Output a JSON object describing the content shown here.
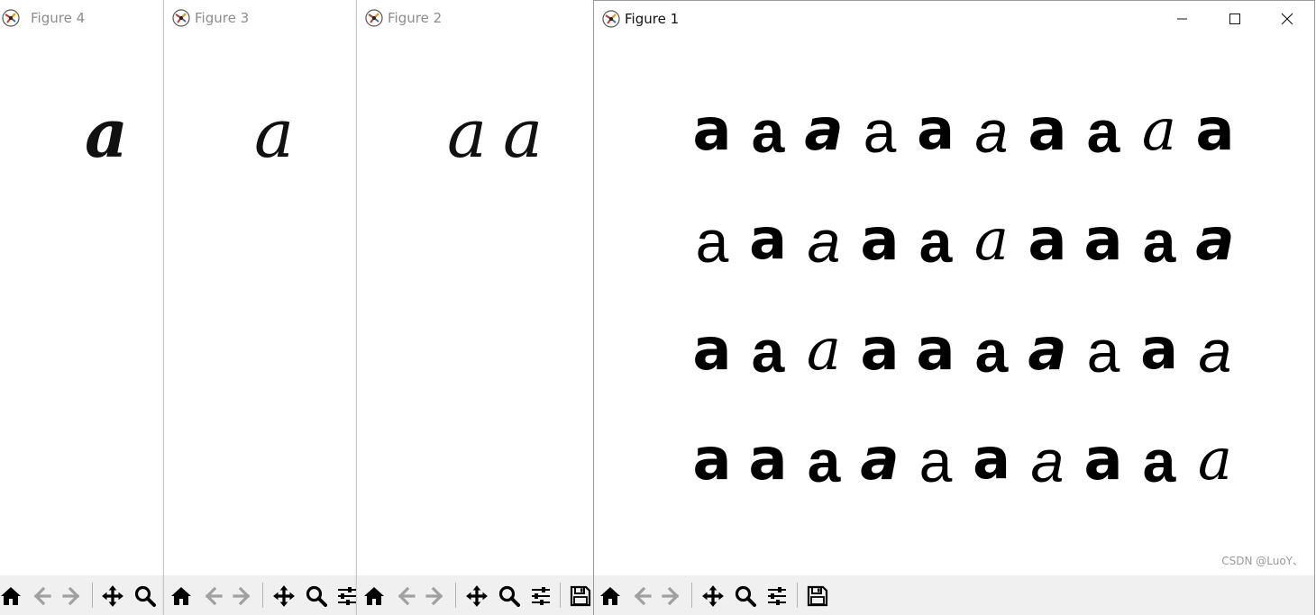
{
  "figures": [
    {
      "id": "figure4",
      "title": "Figure 4",
      "glyphs": [
        "a"
      ]
    },
    {
      "id": "figure3",
      "title": "Figure 3",
      "glyphs": [
        "a"
      ]
    },
    {
      "id": "figure2",
      "title": "Figure 2",
      "glyphs": [
        "a",
        "a"
      ]
    },
    {
      "id": "figure1",
      "title": "Figure 1",
      "grid": [
        [
          "a",
          "a",
          "a",
          "a",
          "a",
          "a",
          "a",
          "a",
          "a",
          "a"
        ],
        [
          "a",
          "a",
          "a",
          "a",
          "a",
          "a",
          "a",
          "a",
          "a",
          "a"
        ],
        [
          "a",
          "a",
          "a",
          "a",
          "a",
          "a",
          "a",
          "a",
          "a",
          "a"
        ],
        [
          "a",
          "a",
          "a",
          "a",
          "a",
          "a",
          "a",
          "a",
          "a",
          "a"
        ]
      ]
    }
  ],
  "toolbar": {
    "icons": [
      "home-icon",
      "back-arrow-icon",
      "forward-arrow-icon",
      "pan-icon",
      "zoom-icon",
      "configure-subplots-icon",
      "save-icon"
    ]
  },
  "window_controls": {
    "icons": [
      "minimize-icon",
      "maximize-icon",
      "close-icon"
    ]
  },
  "watermark": "CSDN @LuoY、",
  "colors": {
    "toolbar_bg": "#f0f0f0",
    "inactive_title": "#8c8c8c",
    "active_title": "#111111"
  }
}
